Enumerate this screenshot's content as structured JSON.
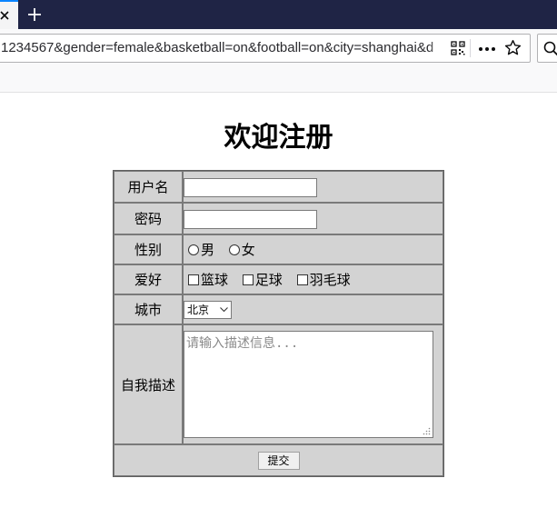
{
  "browser": {
    "url": "1234567&gender=female&basketball=on&football=on&city=shanghai&d",
    "new_tab_symbol": "+",
    "icons": [
      "close-icon",
      "plus-icon",
      "qr-code-icon",
      "more-dots-icon",
      "star-icon",
      "search-icon"
    ]
  },
  "page": {
    "title": "欢迎注册",
    "form": {
      "username_label": "用户名",
      "password_label": "密码",
      "gender_label": "性别",
      "gender_options": [
        "男",
        "女"
      ],
      "hobby_label": "爱好",
      "hobby_options": [
        "篮球",
        "足球",
        "羽毛球"
      ],
      "city_label": "城市",
      "city_selected": "北京",
      "description_label": "自我描述",
      "description_placeholder": "请输入描述信息...",
      "submit_label": "提交"
    }
  },
  "colors": {
    "tabbar": "#1f2445",
    "accent": "#0a84ff",
    "table_bg": "#d3d3d3"
  }
}
